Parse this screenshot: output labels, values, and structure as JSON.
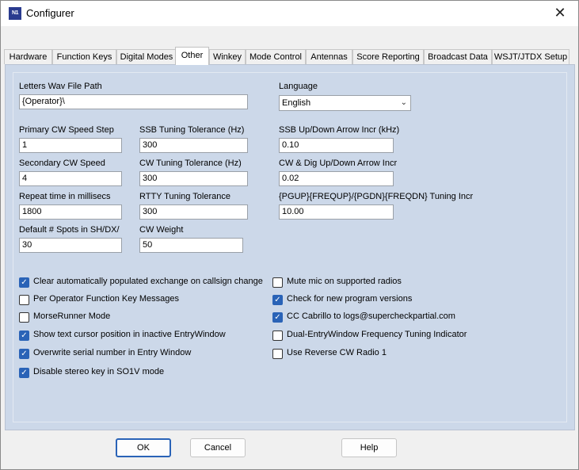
{
  "window": {
    "title": "Configurer",
    "icon_text": "N1",
    "close_icon": "close-icon"
  },
  "tabs": [
    {
      "label": "Hardware"
    },
    {
      "label": "Function Keys"
    },
    {
      "label": "Digital Modes"
    },
    {
      "label": "Other",
      "active": true
    },
    {
      "label": "Winkey"
    },
    {
      "label": "Mode Control"
    },
    {
      "label": "Antennas"
    },
    {
      "label": "Score Reporting"
    },
    {
      "label": "Broadcast Data"
    },
    {
      "label": "WSJT/JTDX Setup"
    }
  ],
  "fields": {
    "wav_path": {
      "label": "Letters Wav File Path",
      "value": "{Operator}\\"
    },
    "language": {
      "label": "Language",
      "value": "English"
    },
    "primary_cw": {
      "label": "Primary CW Speed Step",
      "value": "1"
    },
    "secondary_cw": {
      "label": "Secondary CW Speed",
      "value": "4"
    },
    "repeat_time": {
      "label": "Repeat time in millisecs",
      "value": "1800"
    },
    "spots": {
      "label": "Default # Spots in SH/DX/",
      "value": "30"
    },
    "ssb_tol": {
      "label": "SSB Tuning Tolerance (Hz)",
      "value": "300"
    },
    "cw_tol": {
      "label": "CW Tuning Tolerance (Hz)",
      "value": "300"
    },
    "rtty_tol": {
      "label": "RTTY Tuning Tolerance",
      "value": "300"
    },
    "cw_weight": {
      "label": "CW Weight",
      "value": "50"
    },
    "ssb_arrow": {
      "label": "SSB Up/Down Arrow Incr (kHz)",
      "value": "0.10"
    },
    "cw_arrow": {
      "label": "CW & Dig Up/Down Arrow Incr",
      "value": "0.02"
    },
    "pg_incr": {
      "label": "{PGUP}{FREQUP}/{PGDN}{FREQDN} Tuning Incr",
      "value": "10.00"
    }
  },
  "checkboxes_left": [
    {
      "label": "Clear automatically populated exchange on callsign change",
      "checked": true
    },
    {
      "label": "Per Operator Function Key Messages",
      "checked": false
    },
    {
      "label": "MorseRunner Mode",
      "checked": false
    },
    {
      "label": "Show text cursor position in inactive EntryWindow",
      "checked": true
    },
    {
      "label": "Overwrite serial number in Entry Window",
      "checked": true
    },
    {
      "label": "Disable stereo key in SO1V mode",
      "checked": true
    }
  ],
  "checkboxes_right": [
    {
      "label": "Mute mic on supported radios",
      "checked": false
    },
    {
      "label": "Check for new program versions",
      "checked": true
    },
    {
      "label": "CC Cabrillo to logs@supercheckpartial.com",
      "checked": true
    },
    {
      "label": "Dual-EntryWindow Frequency Tuning Indicator",
      "checked": false
    },
    {
      "label": "Use Reverse CW Radio 1",
      "checked": false
    }
  ],
  "buttons": {
    "ok": "OK",
    "cancel": "Cancel",
    "help": "Help"
  },
  "colors": {
    "panel": "#ccd8e9",
    "accent": "#2a63b7"
  }
}
